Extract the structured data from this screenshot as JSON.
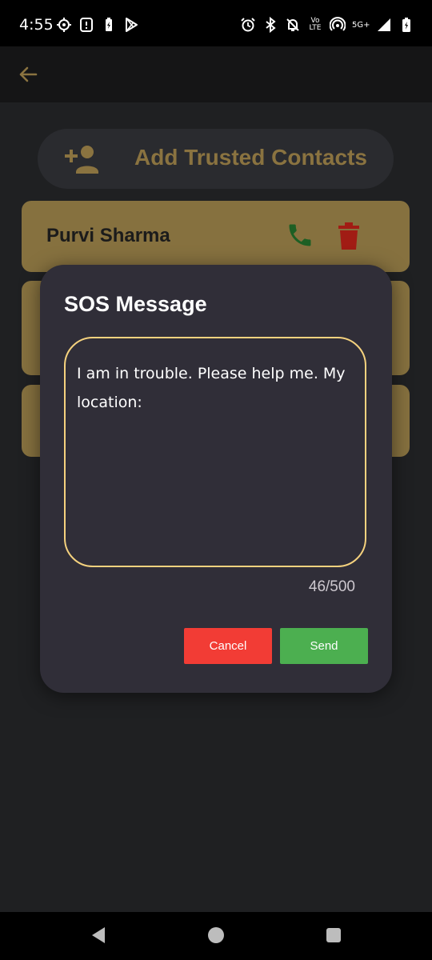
{
  "status_bar": {
    "time": "4:55",
    "network": "5G+",
    "volte_top": "Vo",
    "volte_bottom": "LTE"
  },
  "app_bar": {
    "back_icon": "arrow-left-icon"
  },
  "add_contacts": {
    "label": "Add Trusted Contacts",
    "icon": "person-add-icon"
  },
  "contacts": [
    {
      "name": "Purvi Sharma"
    }
  ],
  "dialog": {
    "title": "SOS Message",
    "message": "I am in trouble. Please help me. My\nlocation:",
    "counter": "46/500",
    "cancel_label": "Cancel",
    "send_label": "Send"
  },
  "colors": {
    "accent_gold": "#86713f",
    "border_gold": "#f5d27e",
    "cancel_red": "#f23c35",
    "send_green": "#4caf50",
    "call_green": "#1d5f24",
    "delete_red": "#a11c14"
  }
}
